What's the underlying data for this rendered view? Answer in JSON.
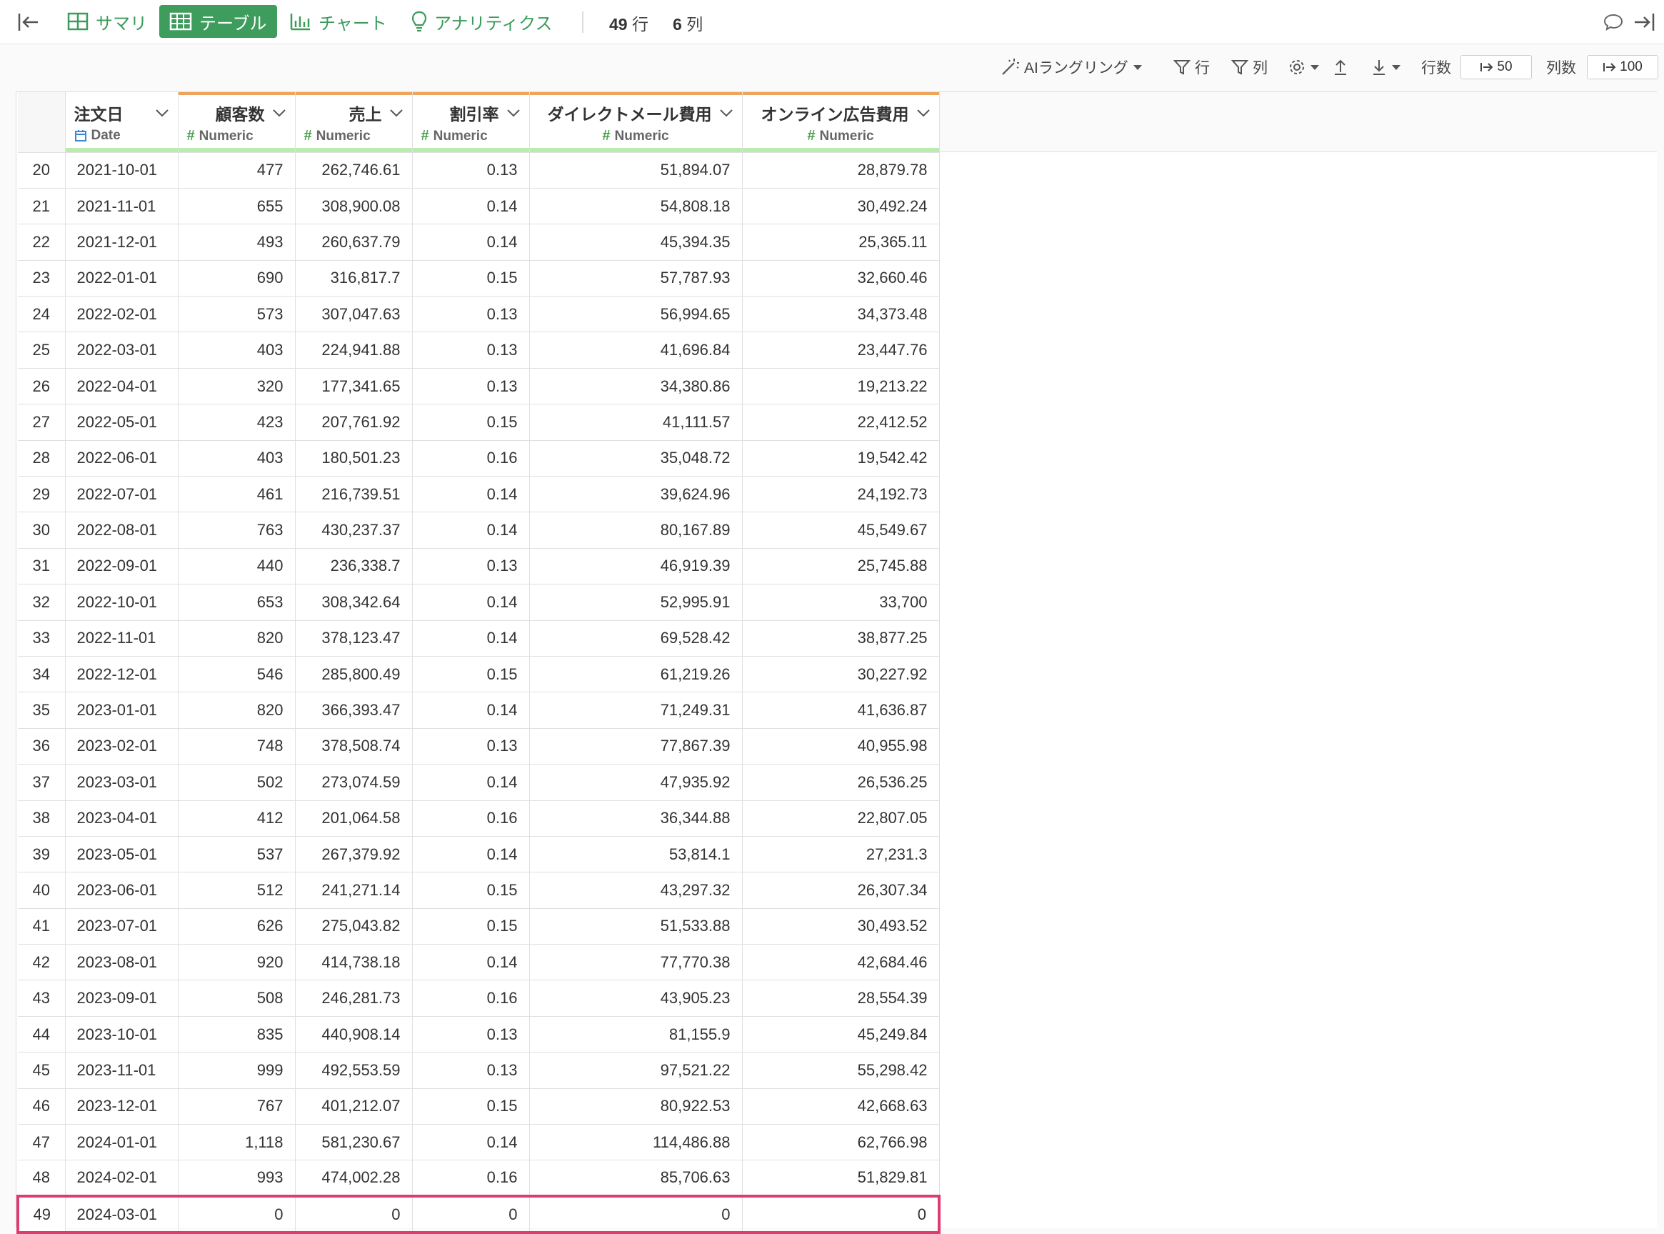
{
  "topbar": {
    "tabs": [
      {
        "label": "サマリ",
        "icon": "grid-icon"
      },
      {
        "label": "テーブル",
        "icon": "table-icon",
        "active": true
      },
      {
        "label": "チャート",
        "icon": "bar-chart-icon"
      },
      {
        "label": "アナリティクス",
        "icon": "lightbulb-icon"
      }
    ],
    "rows_count": "49",
    "rows_unit": "行",
    "cols_count": "6",
    "cols_unit": "列"
  },
  "toolbar": {
    "ai_label": "AIラングリング",
    "row_filter_label": "行",
    "col_filter_label": "列",
    "rowcount_label": "行数",
    "rowcount_value": "50",
    "colcount_label": "列数",
    "colcount_value": "100"
  },
  "colors": {
    "accent": "#3e9c5c",
    "highlight": "#de3b6e",
    "header_bar_orange": "#f0a35a",
    "header_bar_green": "#b9ecae"
  },
  "columns": [
    {
      "name": "注文日",
      "type": "Date"
    },
    {
      "name": "顧客数",
      "type": "Numeric"
    },
    {
      "name": "売上",
      "type": "Numeric"
    },
    {
      "name": "割引率",
      "type": "Numeric"
    },
    {
      "name": "ダイレクトメール費用",
      "type": "Numeric"
    },
    {
      "name": "オンライン広告費用",
      "type": "Numeric"
    }
  ],
  "rows": [
    [
      "20",
      "2021-10-01",
      "477",
      "262,746.61",
      "0.13",
      "51,894.07",
      "28,879.78"
    ],
    [
      "21",
      "2021-11-01",
      "655",
      "308,900.08",
      "0.14",
      "54,808.18",
      "30,492.24"
    ],
    [
      "22",
      "2021-12-01",
      "493",
      "260,637.79",
      "0.14",
      "45,394.35",
      "25,365.11"
    ],
    [
      "23",
      "2022-01-01",
      "690",
      "316,817.7",
      "0.15",
      "57,787.93",
      "32,660.46"
    ],
    [
      "24",
      "2022-02-01",
      "573",
      "307,047.63",
      "0.13",
      "56,994.65",
      "34,373.48"
    ],
    [
      "25",
      "2022-03-01",
      "403",
      "224,941.88",
      "0.13",
      "41,696.84",
      "23,447.76"
    ],
    [
      "26",
      "2022-04-01",
      "320",
      "177,341.65",
      "0.13",
      "34,380.86",
      "19,213.22"
    ],
    [
      "27",
      "2022-05-01",
      "423",
      "207,761.92",
      "0.15",
      "41,111.57",
      "22,412.52"
    ],
    [
      "28",
      "2022-06-01",
      "403",
      "180,501.23",
      "0.16",
      "35,048.72",
      "19,542.42"
    ],
    [
      "29",
      "2022-07-01",
      "461",
      "216,739.51",
      "0.14",
      "39,624.96",
      "24,192.73"
    ],
    [
      "30",
      "2022-08-01",
      "763",
      "430,237.37",
      "0.14",
      "80,167.89",
      "45,549.67"
    ],
    [
      "31",
      "2022-09-01",
      "440",
      "236,338.7",
      "0.13",
      "46,919.39",
      "25,745.88"
    ],
    [
      "32",
      "2022-10-01",
      "653",
      "308,342.64",
      "0.14",
      "52,995.91",
      "33,700"
    ],
    [
      "33",
      "2022-11-01",
      "820",
      "378,123.47",
      "0.14",
      "69,528.42",
      "38,877.25"
    ],
    [
      "34",
      "2022-12-01",
      "546",
      "285,800.49",
      "0.15",
      "61,219.26",
      "30,227.92"
    ],
    [
      "35",
      "2023-01-01",
      "820",
      "366,393.47",
      "0.14",
      "71,249.31",
      "41,636.87"
    ],
    [
      "36",
      "2023-02-01",
      "748",
      "378,508.74",
      "0.13",
      "77,867.39",
      "40,955.98"
    ],
    [
      "37",
      "2023-03-01",
      "502",
      "273,074.59",
      "0.14",
      "47,935.92",
      "26,536.25"
    ],
    [
      "38",
      "2023-04-01",
      "412",
      "201,064.58",
      "0.16",
      "36,344.88",
      "22,807.05"
    ],
    [
      "39",
      "2023-05-01",
      "537",
      "267,379.92",
      "0.14",
      "53,814.1",
      "27,231.3"
    ],
    [
      "40",
      "2023-06-01",
      "512",
      "241,271.14",
      "0.15",
      "43,297.32",
      "26,307.34"
    ],
    [
      "41",
      "2023-07-01",
      "626",
      "275,043.82",
      "0.15",
      "51,533.88",
      "30,493.52"
    ],
    [
      "42",
      "2023-08-01",
      "920",
      "414,738.18",
      "0.14",
      "77,770.38",
      "42,684.46"
    ],
    [
      "43",
      "2023-09-01",
      "508",
      "246,281.73",
      "0.16",
      "43,905.23",
      "28,554.39"
    ],
    [
      "44",
      "2023-10-01",
      "835",
      "440,908.14",
      "0.13",
      "81,155.9",
      "45,249.84"
    ],
    [
      "45",
      "2023-11-01",
      "999",
      "492,553.59",
      "0.13",
      "97,521.22",
      "55,298.42"
    ],
    [
      "46",
      "2023-12-01",
      "767",
      "401,212.07",
      "0.15",
      "80,922.53",
      "42,668.63"
    ],
    [
      "47",
      "2024-01-01",
      "1,118",
      "581,230.67",
      "0.14",
      "114,486.88",
      "62,766.98"
    ],
    [
      "48",
      "2024-02-01",
      "993",
      "474,002.28",
      "0.16",
      "85,706.63",
      "51,829.81"
    ],
    [
      "49",
      "2024-03-01",
      "0",
      "0",
      "0",
      "0",
      "0"
    ]
  ],
  "highlighted_row": "49"
}
